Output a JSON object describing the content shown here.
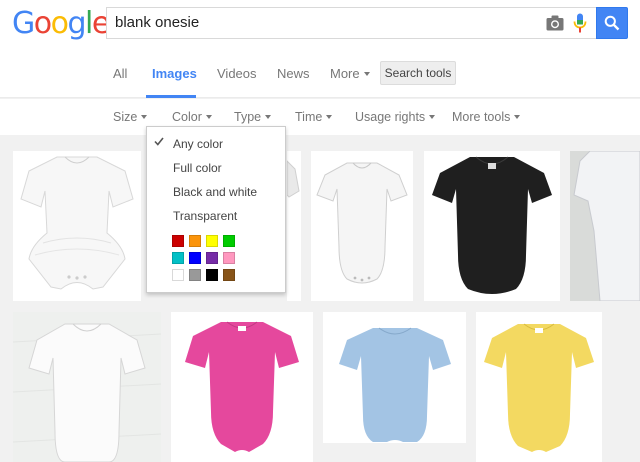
{
  "header": {
    "logo_letters": [
      {
        "ch": "G",
        "color": "#4285f4"
      },
      {
        "ch": "o",
        "color": "#ea4335"
      },
      {
        "ch": "o",
        "color": "#fbbc05"
      },
      {
        "ch": "g",
        "color": "#4285f4"
      },
      {
        "ch": "l",
        "color": "#34a853"
      },
      {
        "ch": "e",
        "color": "#ea4335"
      }
    ],
    "query": "blank onesie",
    "icons": [
      "camera-icon",
      "microphone-icon",
      "search-icon"
    ],
    "search_button_color": "#4285f4"
  },
  "tabs": {
    "items": [
      {
        "label": "All",
        "active": false
      },
      {
        "label": "Images",
        "active": true
      },
      {
        "label": "Videos",
        "active": false
      },
      {
        "label": "News",
        "active": false
      },
      {
        "label": "More",
        "active": false
      }
    ],
    "search_tools": "Search tools"
  },
  "filters": [
    "Size",
    "Color",
    "Type",
    "Time",
    "Usage rights",
    "More tools"
  ],
  "color_menu": {
    "items": [
      {
        "label": "Any color",
        "selected": true
      },
      {
        "label": "Full color",
        "selected": false
      },
      {
        "label": "Black and white",
        "selected": false
      },
      {
        "label": "Transparent",
        "selected": false
      }
    ],
    "swatches": [
      [
        "#cc0000",
        "#fb940b",
        "#ffff00",
        "#00cc00"
      ],
      [
        "#03c0c6",
        "#0000ff",
        "#762ca7",
        "#ff98bf"
      ],
      [
        "#ffffff",
        "#999999",
        "#000000",
        "#885418"
      ]
    ]
  },
  "results": [
    {
      "name": "white-tutu-onesie",
      "color": "#f7f7f7"
    },
    {
      "name": "white-onesie",
      "color": "#f5f5f5"
    },
    {
      "name": "black-onesie",
      "color": "#1f1f1f"
    },
    {
      "name": "white-onesie-grey-bg",
      "color": "#f2f3f5"
    },
    {
      "name": "white-onesie-wood-bg",
      "color": "#fbfbfb"
    },
    {
      "name": "pink-onesie",
      "color": "#e5489d"
    },
    {
      "name": "blue-onesie",
      "color": "#a3c4e4"
    },
    {
      "name": "yellow-onesie",
      "color": "#f3d961"
    }
  ]
}
